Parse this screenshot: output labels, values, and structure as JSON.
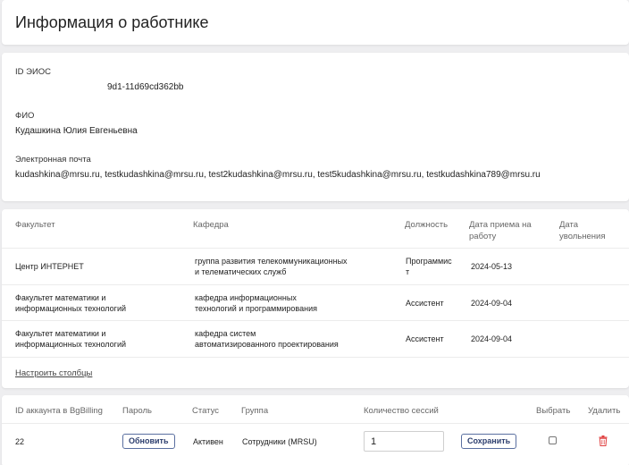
{
  "header": {
    "title": "Информация о работнике"
  },
  "info": {
    "eios_label": "ID ЭИОС",
    "eios_value": "9d1-11d69cd362bb",
    "fio_label": "ФИО",
    "fio_value": "Кудашкина Юлия Евгеньевна",
    "email_label": "Электронная почта",
    "email_value": "kudashkina@mrsu.ru, testkudashkina@mrsu.ru, test2kudashkina@mrsu.ru, test5kudashkina@mrsu.ru, testkudashkina789@mrsu.ru"
  },
  "employment": {
    "headers": {
      "faculty": "Факультет",
      "department": "Кафедра",
      "position": "Должность",
      "hire_date_1": "Дата приема на",
      "hire_date_2": "работу",
      "dismiss_date_1": "Дата",
      "dismiss_date_2": "увольнения"
    },
    "rows": [
      {
        "faculty_1": "Центр ИНТЕРНЕТ",
        "faculty_2": "",
        "department_1": "группа развития телекоммуникационных",
        "department_2": "и телематических служб",
        "position_1": "Программис",
        "position_2": "т",
        "hire_date": "2024-05-13",
        "dismiss_date": ""
      },
      {
        "faculty_1": "Факультет математики и",
        "faculty_2": "информационных технологий",
        "department_1": "кафедра информационных",
        "department_2": "технологий и программирования",
        "position_1": "Ассистент",
        "position_2": "",
        "hire_date": "2024-09-04",
        "dismiss_date": ""
      },
      {
        "faculty_1": "Факультет математики и",
        "faculty_2": "информационных технологий",
        "department_1": "кафедра систем",
        "department_2": "автоматизированного проектирования",
        "position_1": "Ассистент",
        "position_2": "",
        "hire_date": "2024-09-04",
        "dismiss_date": ""
      }
    ],
    "configure_link": "Настроить столбцы"
  },
  "accounts": {
    "headers": {
      "id": "ID аккаунта в BgBilling",
      "password": "Пароль",
      "status": "Статус",
      "group": "Группа",
      "sessions": "Количество сессий",
      "select": "Выбрать",
      "delete": "Удалить"
    },
    "rows": [
      {
        "id": "22",
        "update_label": "Обновить",
        "status": "Активен",
        "group": "Сотрудники (MRSU)",
        "sessions_value": "1",
        "save_label": "Сохранить"
      }
    ]
  },
  "colors": {
    "delete_icon": "#e04040",
    "button_border": "#5a6fa0"
  },
  "icons": {
    "delete": "trash-icon"
  }
}
